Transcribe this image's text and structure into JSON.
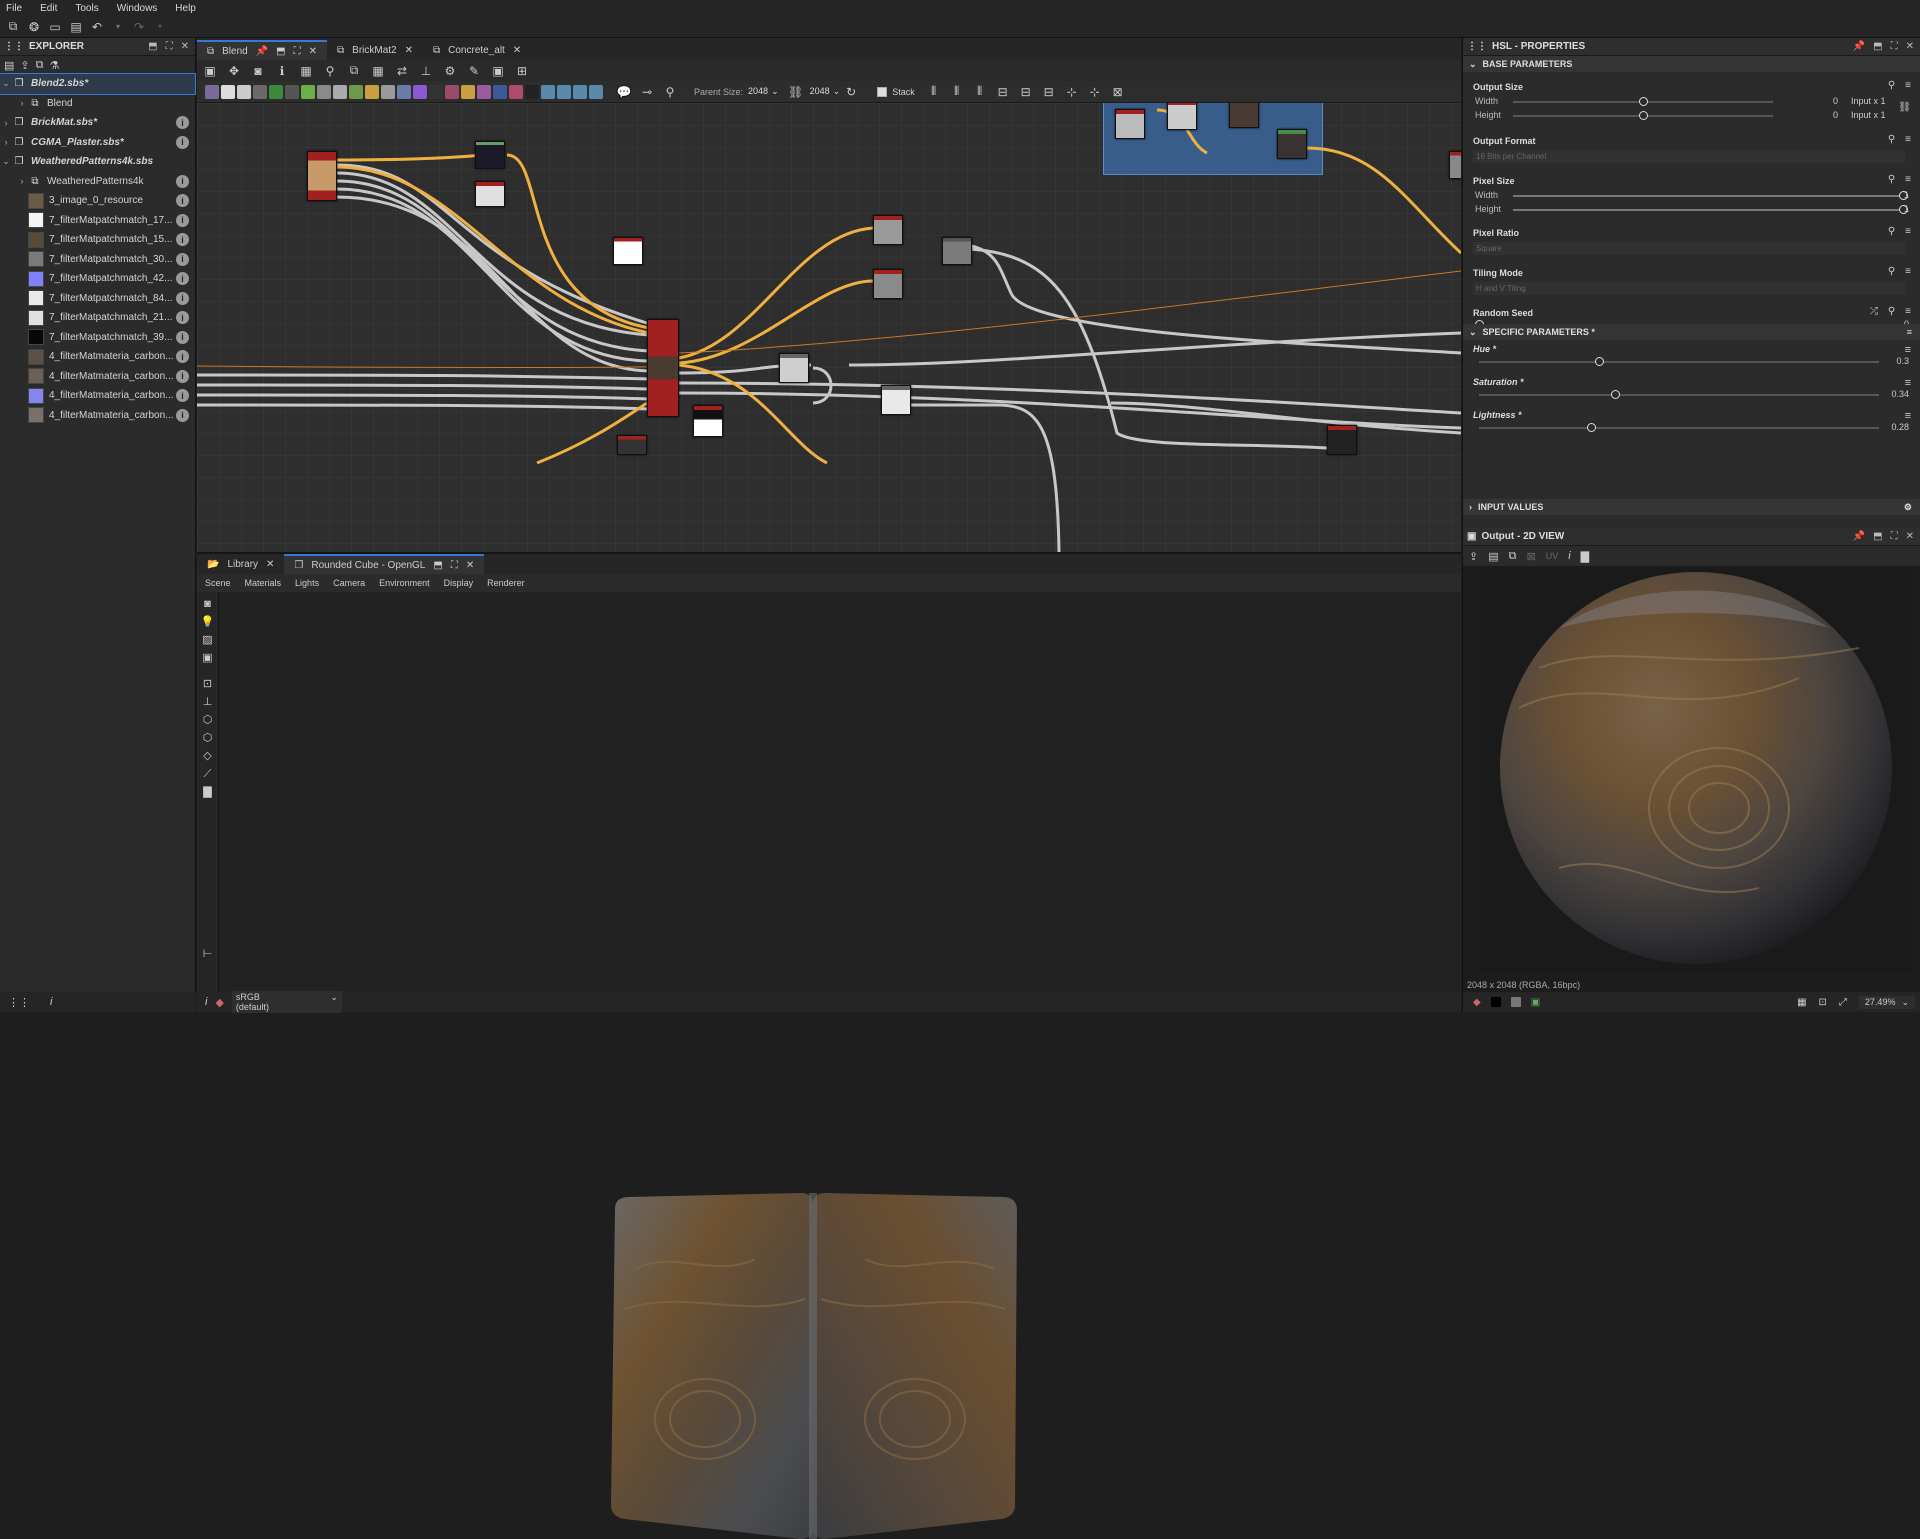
{
  "menu": [
    "File",
    "Edit",
    "Tools",
    "Windows",
    "Help"
  ],
  "explorer": {
    "title": "EXPLORER",
    "items": [
      {
        "label": "Blend2.sbs*",
        "level": 0,
        "bold": true,
        "selected": true,
        "expanded": true,
        "swatch": ""
      },
      {
        "label": "Blend",
        "level": 1,
        "bold": false,
        "graph": true,
        "swatch": ""
      },
      {
        "label": "BrickMat.sbs*",
        "level": 0,
        "bold": true,
        "collapsed": true,
        "swatch": ""
      },
      {
        "label": "CGMA_Plaster.sbs*",
        "level": 0,
        "bold": true,
        "collapsed": true,
        "swatch": ""
      },
      {
        "label": "WeatheredPatterns4k.sbs",
        "level": 0,
        "bold": true,
        "expanded": true,
        "swatch": ""
      },
      {
        "label": "WeatheredPatterns4k",
        "level": 1,
        "graph": true,
        "swatch": ""
      },
      {
        "label": "3_image_0_resource",
        "level": 1,
        "swatch": "#6a5a48"
      },
      {
        "label": "7_filterMatpatchmatch_17...",
        "level": 1,
        "swatch": "#f4f4f4"
      },
      {
        "label": "7_filterMatpatchmatch_15...",
        "level": 1,
        "swatch": "#5a4a3c"
      },
      {
        "label": "7_filterMatpatchmatch_30...",
        "level": 1,
        "swatch": "#7a7a7a"
      },
      {
        "label": "7_filterMatpatchmatch_42...",
        "level": 1,
        "swatch": "#8080ff"
      },
      {
        "label": "7_filterMatpatchmatch_84...",
        "level": 1,
        "swatch": "#e8e8e8"
      },
      {
        "label": "7_filterMatpatchmatch_21...",
        "level": 1,
        "swatch": "#e0e0e0"
      },
      {
        "label": "7_filterMatpatchmatch_39...",
        "level": 1,
        "swatch": "#080808"
      },
      {
        "label": "4_filterMatmateria_carbon...",
        "level": 1,
        "swatch": "#5a5046"
      },
      {
        "label": "4_filterMatmateria_carbon...",
        "level": 1,
        "swatch": "#6a6058"
      },
      {
        "label": "4_filterMatmateria_carbon...",
        "level": 1,
        "swatch": "#8686f0"
      },
      {
        "label": "4_filterMatmateria_carbon...",
        "level": 1,
        "swatch": "#7a7068"
      }
    ]
  },
  "graph_tabs": [
    {
      "label": "Blend",
      "active": true
    },
    {
      "label": "BrickMat2",
      "active": false
    },
    {
      "label": "Concrete_alt",
      "active": false
    }
  ],
  "graph_toolbar": {
    "parent_size_label": "Parent Size:",
    "parent_size_value": "2048",
    "size_value": "2048",
    "stack_label": "Stack"
  },
  "view_tabs": [
    {
      "label": "Library",
      "active": false
    },
    {
      "label": "Rounded Cube - OpenGL",
      "active": true
    }
  ],
  "view_menu": [
    "Scene",
    "Materials",
    "Lights",
    "Camera",
    "Environment",
    "Display",
    "Renderer"
  ],
  "view_status": {
    "colorspace": "sRGB (default)"
  },
  "properties": {
    "title": "HSL - PROPERTIES",
    "base_section": "BASE PARAMETERS",
    "output_size": {
      "label": "Output Size",
      "width_label": "Width",
      "height_label": "Height",
      "width_value": "0",
      "height_value": "0",
      "width_mode": "Input x 1",
      "height_mode": "Input x 1",
      "width_pos": 0.5,
      "height_pos": 0.5
    },
    "output_format": {
      "label": "Output Format",
      "value": "16 Bits per Channel"
    },
    "pixel_size": {
      "label": "Pixel Size",
      "width_label": "Width",
      "height_label": "Height",
      "width_value": "1",
      "height_value": "1",
      "width_pos": 1.0,
      "height_pos": 1.0
    },
    "pixel_ratio": {
      "label": "Pixel Ratio",
      "value": "Square"
    },
    "tiling_mode": {
      "label": "Tiling Mode",
      "value": "H and V Tiling"
    },
    "random_seed": {
      "label": "Random Seed",
      "value": "0",
      "pos": 0.0
    },
    "specific_section": "SPECIFIC PARAMETERS *",
    "hue": {
      "label": "Hue *",
      "value": "0.3",
      "pos": 0.3
    },
    "saturation": {
      "label": "Saturation *",
      "value": "0.34",
      "pos": 0.34
    },
    "lightness": {
      "label": "Lightness *",
      "value": "0.28",
      "pos": 0.28
    },
    "input_section": "INPUT VALUES"
  },
  "output2d": {
    "title": "Output - 2D VIEW",
    "uv_label": "UV",
    "info": "2048 x 2048 (RGBA, 16bpc)",
    "zoom": "27.49%"
  },
  "colors": {
    "accent": "#3b78d6",
    "node_red": "#a12020",
    "wire_orange": "#f0b040",
    "frame_blue": "#3c6eaa"
  }
}
